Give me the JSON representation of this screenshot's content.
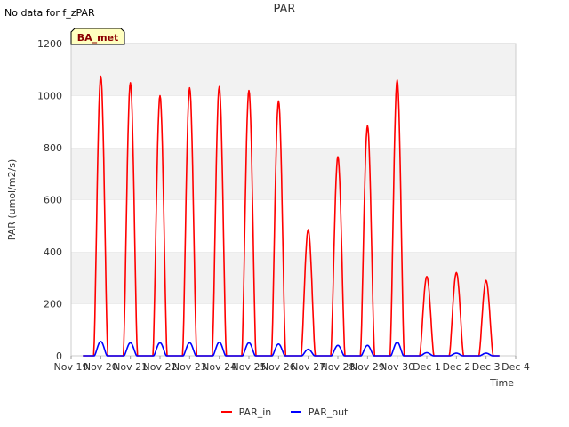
{
  "header": {
    "no_data_text": "No data for f_zPAR"
  },
  "site_label": "BA_met",
  "colors": {
    "PAR_in": "#ff0000",
    "PAR_out": "#0000ff",
    "band": "#f2f2f2",
    "site_box": "#ffffc0"
  },
  "chart_data": {
    "type": "line",
    "title": "PAR",
    "xlabel": "Time",
    "ylabel": "PAR (umol/m2/s)",
    "xlim": [
      "Nov 19",
      "Dec 4"
    ],
    "ylim": [
      0,
      1200
    ],
    "yticks": [
      0,
      200,
      400,
      600,
      800,
      1000,
      1200
    ],
    "xtick_labels": [
      "Nov 19",
      "Nov 20",
      "Nov 21",
      "Nov 22",
      "Nov 23",
      "Nov 24",
      "Nov 25",
      "Nov 26",
      "Nov 27",
      "Nov 28",
      "Nov 29",
      "Nov 30",
      "Dec 1",
      "Dec 2",
      "Dec 3",
      "Dec 4"
    ],
    "grid": "horizontal bands",
    "legend_position": "bottom",
    "series": [
      {
        "name": "PAR_in",
        "color": "#ff0000",
        "daily_peaks": [
          {
            "date": "Nov 20",
            "peak": 1075
          },
          {
            "date": "Nov 21",
            "peak": 1050
          },
          {
            "date": "Nov 22",
            "peak": 1000
          },
          {
            "date": "Nov 23",
            "peak": 1030
          },
          {
            "date": "Nov 24",
            "peak": 1035
          },
          {
            "date": "Nov 25",
            "peak": 1020
          },
          {
            "date": "Nov 26",
            "peak": 980
          },
          {
            "date": "Nov 27",
            "peak": 485
          },
          {
            "date": "Nov 28",
            "peak": 765
          },
          {
            "date": "Nov 29",
            "peak": 885
          },
          {
            "date": "Nov 30",
            "peak": 1060
          },
          {
            "date": "Dec 1",
            "peak": 305
          },
          {
            "date": "Dec 2",
            "peak": 320
          },
          {
            "date": "Dec 3",
            "peak": 290
          }
        ]
      },
      {
        "name": "PAR_out",
        "color": "#0000ff",
        "daily_peaks": [
          {
            "date": "Nov 20",
            "peak": 55
          },
          {
            "date": "Nov 21",
            "peak": 50
          },
          {
            "date": "Nov 22",
            "peak": 50
          },
          {
            "date": "Nov 23",
            "peak": 50
          },
          {
            "date": "Nov 24",
            "peak": 52
          },
          {
            "date": "Nov 25",
            "peak": 50
          },
          {
            "date": "Nov 26",
            "peak": 45
          },
          {
            "date": "Nov 27",
            "peak": 25
          },
          {
            "date": "Nov 28",
            "peak": 40
          },
          {
            "date": "Nov 29",
            "peak": 40
          },
          {
            "date": "Nov 30",
            "peak": 52
          },
          {
            "date": "Dec 1",
            "peak": 12
          },
          {
            "date": "Dec 2",
            "peak": 10
          },
          {
            "date": "Dec 3",
            "peak": 10
          }
        ]
      }
    ]
  }
}
